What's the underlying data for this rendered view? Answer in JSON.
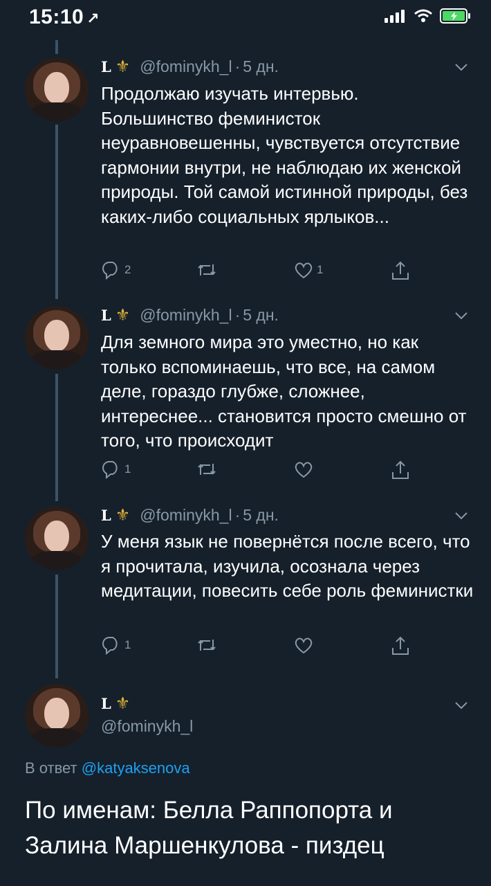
{
  "status": {
    "time": "15:10",
    "location_glyph": "↗"
  },
  "user": {
    "name": "L",
    "emblem": "⚜",
    "handle": "@fominykh_l"
  },
  "tweets": [
    {
      "time": "5 дн.",
      "text": "Продолжаю изучать интервью. Большинство феминисток неуравновешенны, чувствуется отсутствие гармонии внутри, не наблюдаю их женской природы. Той самой истинной природы, без каких-либо социальных ярлыков...",
      "reply_count": "2",
      "retweet_count": "",
      "like_count": "1"
    },
    {
      "time": "5 дн.",
      "text": "Для земного мира это уместно, но как только вспоминаешь, что все,  на самом деле, гораздо глубже, сложнее, интереснее... становится просто смешно от того, что происходит",
      "reply_count": "1",
      "retweet_count": "",
      "like_count": ""
    },
    {
      "time": "5 дн.",
      "text": "У меня язык не повернётся после всего, что я прочитала, изучила, осознала через медитации, повесить себе роль феминистки",
      "reply_count": "1",
      "retweet_count": "",
      "like_count": ""
    }
  ],
  "main_tweet": {
    "reply_prefix": "В ответ",
    "reply_to": "@katyaksenova",
    "text": "По именам: Белла Раппопорта и Залина Маршенкулова - пиздец"
  },
  "colors": {
    "background": "#15202b",
    "secondary_text": "#8899a6",
    "accent": "#1da1f2",
    "battery": "#4cd964"
  }
}
